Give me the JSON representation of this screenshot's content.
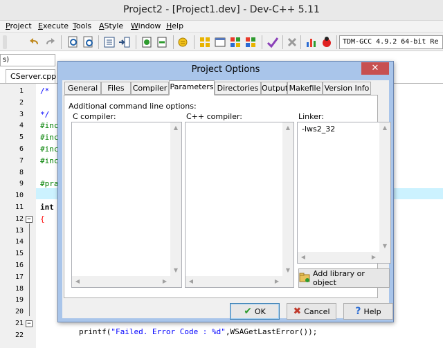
{
  "window": {
    "title": "Project2 - [Project1.dev] - Dev-C++ 5.11"
  },
  "menu": [
    {
      "pre": "",
      "ul": "P",
      "post": "roject"
    },
    {
      "pre": "",
      "ul": "E",
      "post": "xecute"
    },
    {
      "pre": "",
      "ul": "T",
      "post": "ools"
    },
    {
      "pre": "",
      "ul": "A",
      "post": "Style"
    },
    {
      "pre": "",
      "ul": "W",
      "post": "indow"
    },
    {
      "pre": "",
      "ul": "H",
      "post": "elp"
    }
  ],
  "toolbar": {
    "compiler_value": "TDM-GCC 4.9.2 64-bit Re",
    "left_combo_value": "s)"
  },
  "editor": {
    "file_tab": "CServer.cpp",
    "line_numbers": [
      "1",
      "2",
      "3",
      "4",
      "5",
      "6",
      "7",
      "8",
      "9",
      "10",
      "11",
      "12",
      "13",
      "14",
      "15",
      "16",
      "17",
      "18",
      "19",
      "20",
      "21",
      "22"
    ],
    "code_lines": [
      {
        "line": 1,
        "text": "/*"
      },
      {
        "line": 3,
        "text": "*/"
      },
      {
        "line": 4,
        "text": "#inc"
      },
      {
        "line": 5,
        "text": "#inc"
      },
      {
        "line": 6,
        "text": "#inc"
      },
      {
        "line": 7,
        "text": "#inc"
      },
      {
        "line": 9,
        "text": "#pra"
      },
      {
        "line": 11,
        "text": "int"
      },
      {
        "line": 12,
        "text": "{"
      }
    ],
    "bottom_code": "printf(\"Failed. Error Code : %d\",WSAGetLastError());",
    "fold_markers": [
      "−",
      "−"
    ]
  },
  "dialog": {
    "title": "Project Options",
    "close_glyph": "✕",
    "tabs": [
      "General",
      "Files",
      "Compiler",
      "Parameters",
      "Directories",
      "Output",
      "Makefile",
      "Version Info"
    ],
    "active_tab": "Parameters",
    "group_label": "Additional command line options:",
    "c_compiler_label": "C compiler:",
    "cpp_compiler_label": "C++ compiler:",
    "linker_label": "Linker:",
    "c_compiler_value": "",
    "cpp_compiler_value": "",
    "linker_value": "-lws2_32",
    "add_library_button": "Add library or object",
    "ok_button": "OK",
    "cancel_button": "Cancel",
    "help_button": "Help"
  },
  "colors": {
    "comment": "#0000ff",
    "preprocessor": "#008000",
    "string": "#0000ff",
    "highlight_line": "#ccf2ff",
    "dialog_frame": "#a9c5ea",
    "close_button": "#c75050"
  },
  "icons": {
    "toolbar": [
      "new-project-icon",
      "undo-icon",
      "redo-icon",
      "find-icon",
      "replace-icon",
      "goto-icon",
      "indent-icon",
      "add-file-icon",
      "remove-file-icon",
      "class-browser-icon",
      "compile-icon",
      "run-icon",
      "compile-run-icon",
      "rebuild-icon",
      "check-syntax-icon",
      "stop-icon",
      "chart-icon",
      "debug-icon"
    ],
    "dialog": [
      "ok-check-icon",
      "cancel-x-icon",
      "help-question-icon",
      "folder-library-icon"
    ]
  }
}
